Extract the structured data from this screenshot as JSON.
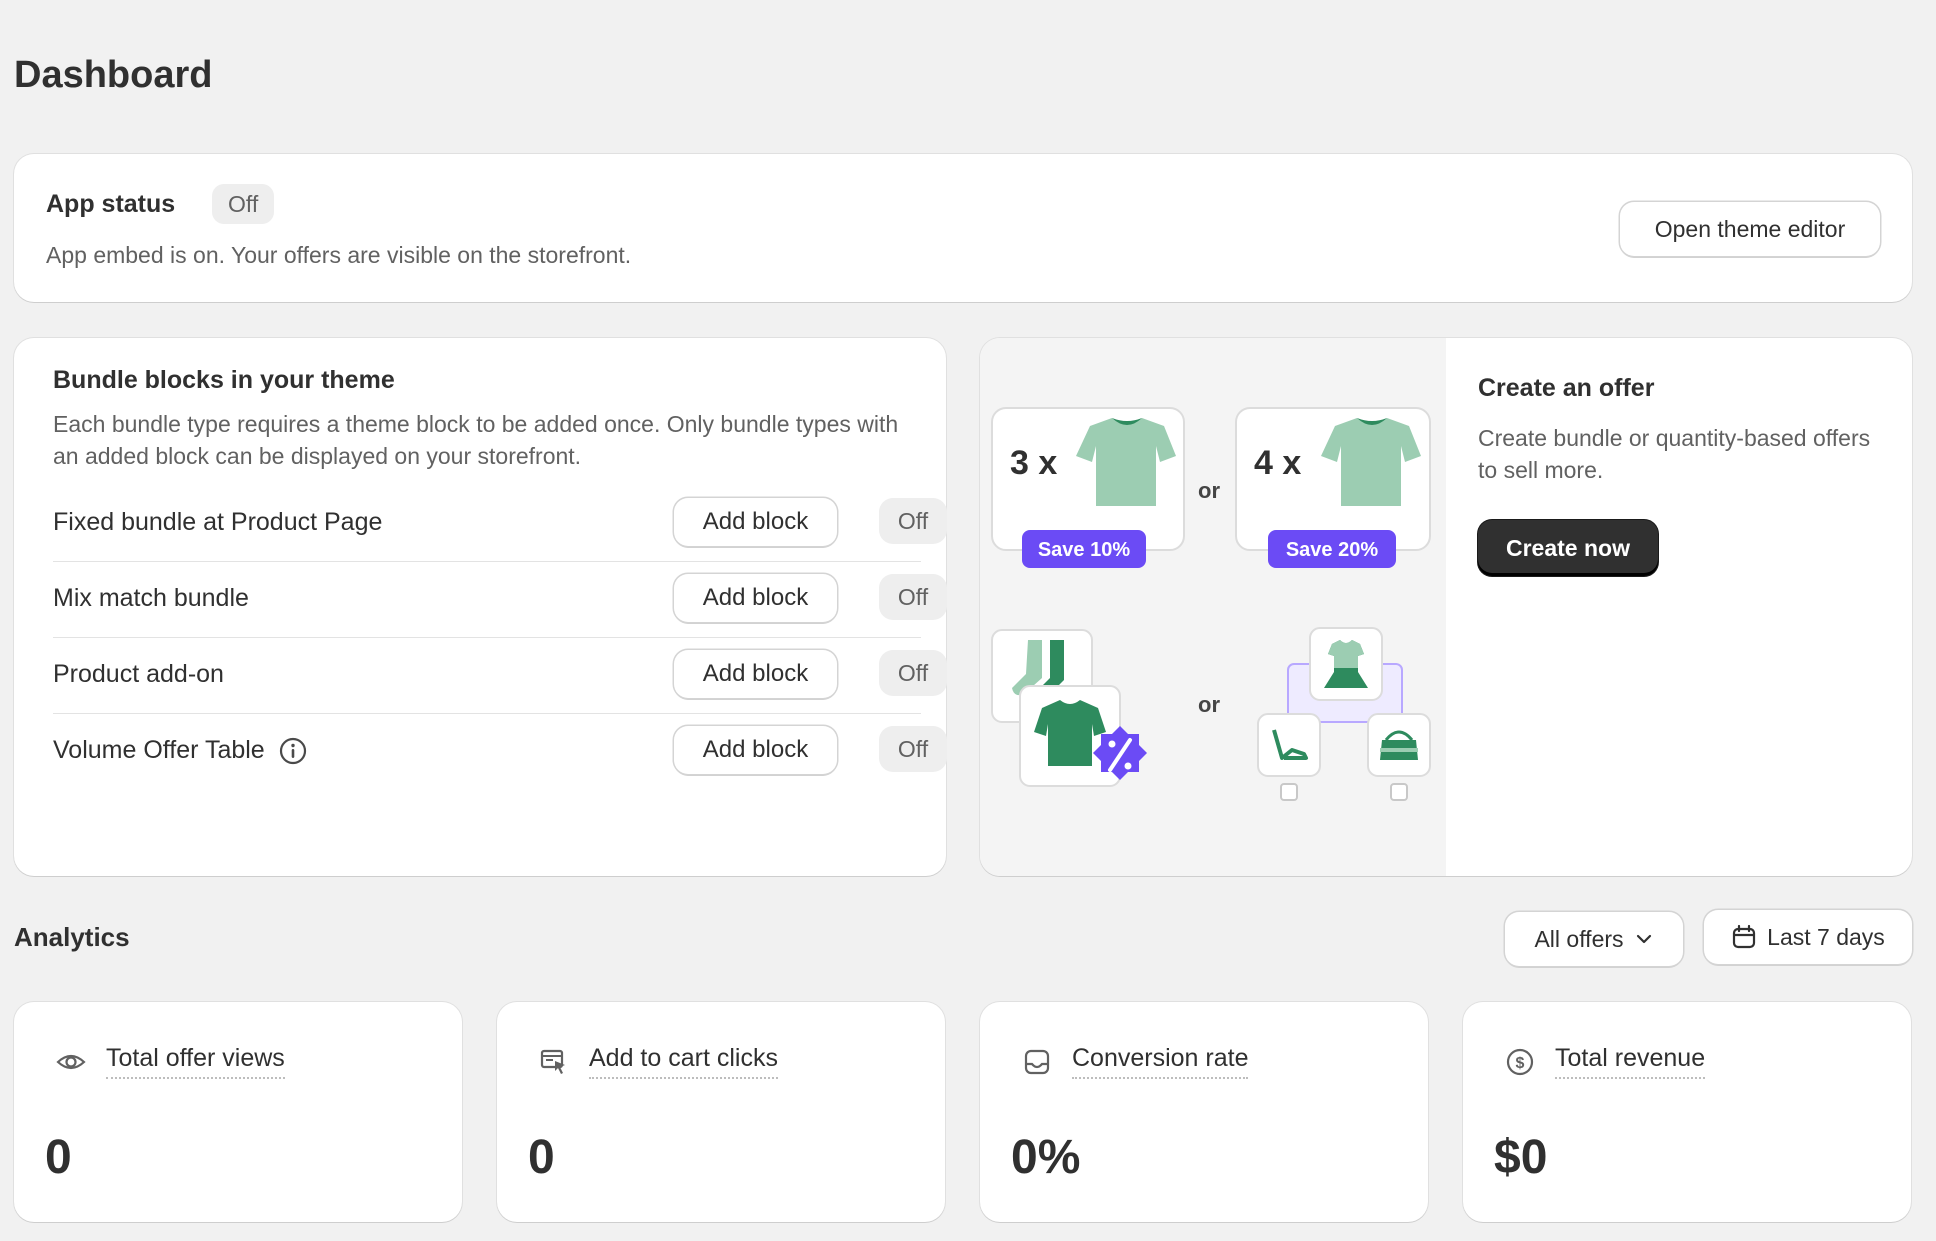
{
  "page": {
    "title": "Dashboard"
  },
  "app_status": {
    "title": "App status",
    "badge": "Off",
    "description": "App embed is on. Your offers are visible on the storefront.",
    "button": "Open theme editor"
  },
  "bundle_blocks": {
    "title": "Bundle blocks in your theme",
    "description": "Each bundle type requires a theme block to be added once. Only bundle types with an added block can be displayed on your storefront.",
    "add_label": "Add block",
    "rows": [
      {
        "label": "Fixed bundle at Product Page",
        "status": "Off"
      },
      {
        "label": "Mix match bundle",
        "status": "Off"
      },
      {
        "label": "Product add-on",
        "status": "Off"
      },
      {
        "label": "Volume Offer Table",
        "status": "Off"
      }
    ]
  },
  "create_offer": {
    "title": "Create an offer",
    "description": "Create bundle or quantity-based offers to sell more.",
    "button": "Create now",
    "illustration": {
      "qty1": "3 x",
      "save1": "Save 10%",
      "qty2": "4 x",
      "save2": "Save 20%",
      "or": "or"
    }
  },
  "analytics": {
    "title": "Analytics",
    "filter_label": "All offers",
    "date_label": "Last 7 days",
    "metrics": [
      {
        "label": "Total offer views",
        "value": "0",
        "icon": "eye-icon"
      },
      {
        "label": "Add to cart clicks",
        "value": "0",
        "icon": "cart-click-icon"
      },
      {
        "label": "Conversion rate",
        "value": "0%",
        "icon": "inbox-icon"
      },
      {
        "label": "Total revenue",
        "value": "$0",
        "icon": "dollar-icon"
      }
    ]
  },
  "colors": {
    "brand_purple": "#6b4bf5",
    "shirt_light": "#9ccdb2",
    "shirt_dark": "#2e8b5e",
    "primary_button": "#303030"
  }
}
